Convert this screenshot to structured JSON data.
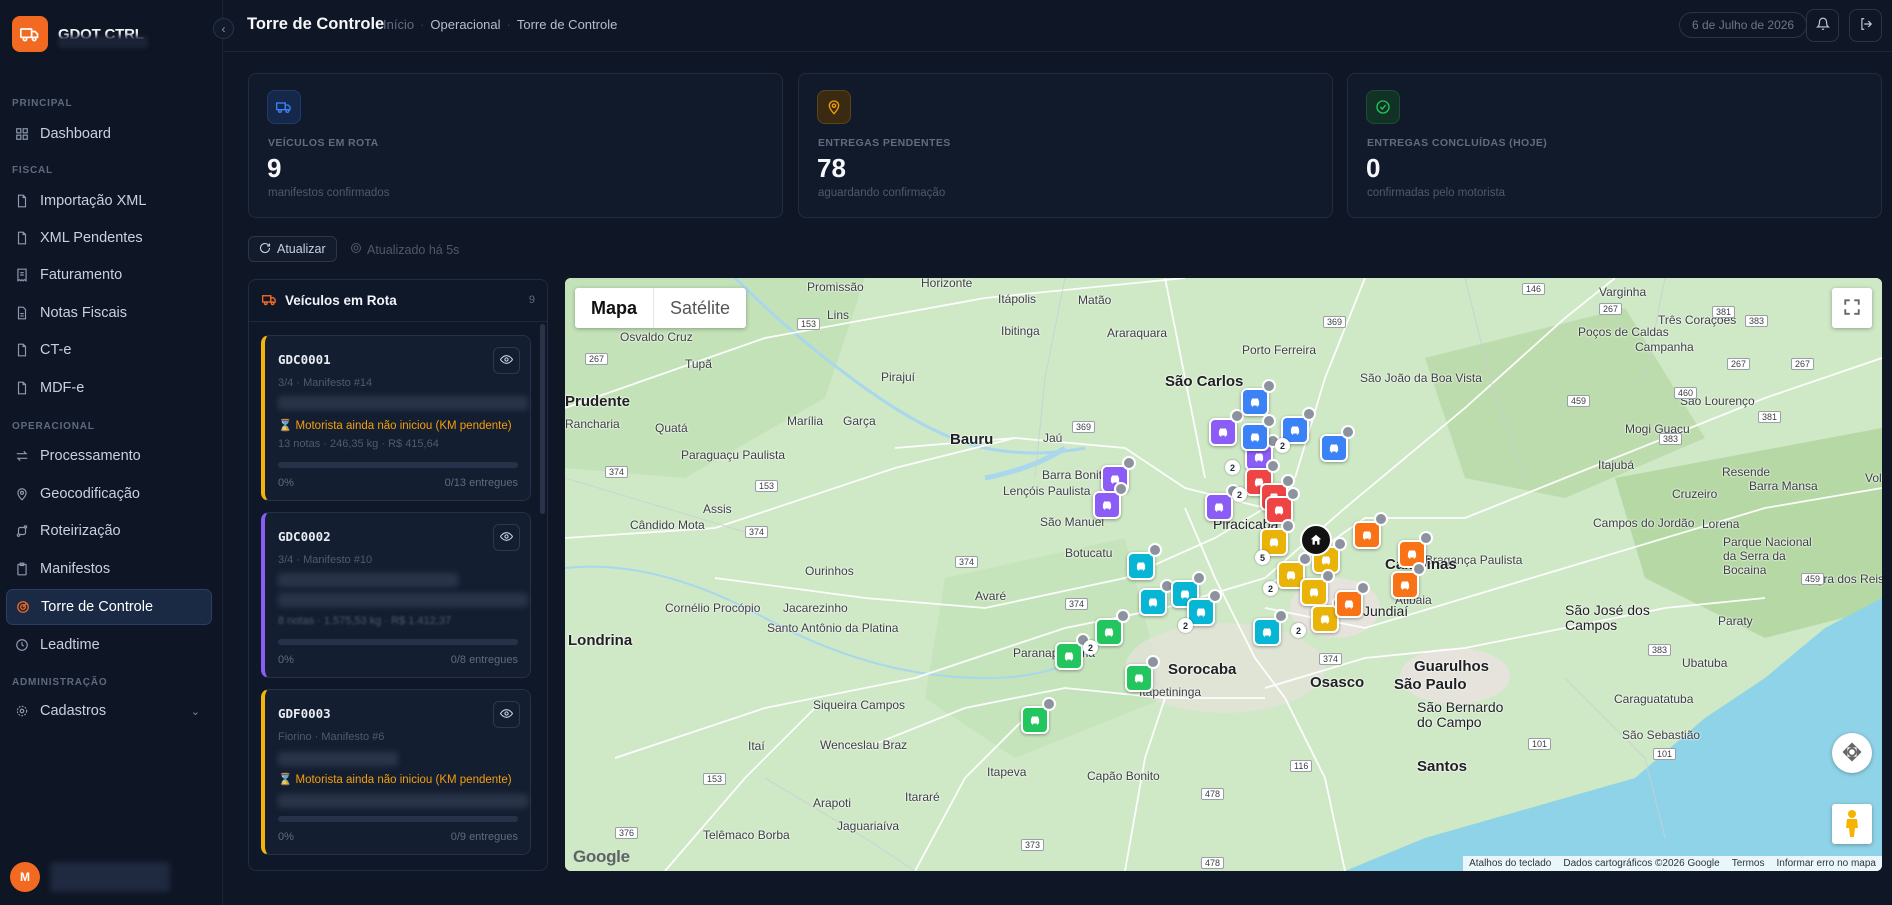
{
  "brand": {
    "name": "GDOT CTRL"
  },
  "sidebar": {
    "sections": {
      "principal": "PRINCIPAL",
      "fiscal": "FISCAL",
      "operacional": "OPERACIONAL",
      "administracao": "ADMINISTRAÇÃO"
    },
    "items": [
      {
        "label": "Dashboard",
        "icon": "grid-icon"
      },
      {
        "label": "Importação XML",
        "icon": "file-icon"
      },
      {
        "label": "XML Pendentes",
        "icon": "file-icon"
      },
      {
        "label": "Faturamento",
        "icon": "receipt-icon"
      },
      {
        "label": "Notas Fiscais",
        "icon": "file-icon"
      },
      {
        "label": "CT-e",
        "icon": "file-icon"
      },
      {
        "label": "MDF-e",
        "icon": "file-icon"
      },
      {
        "label": "Processamento",
        "icon": "arrows-icon"
      },
      {
        "label": "Geocodificação",
        "icon": "map-pin-icon"
      },
      {
        "label": "Roteirização",
        "icon": "route-icon"
      },
      {
        "label": "Manifestos",
        "icon": "clipboard-icon"
      },
      {
        "label": "Torre de Controle",
        "icon": "radar-icon",
        "active": true
      },
      {
        "label": "Leadtime",
        "icon": "clock-icon"
      },
      {
        "label": "Cadastros",
        "icon": "gear-icon"
      }
    ],
    "user_initial": "M"
  },
  "header": {
    "title": "Torre de Controle",
    "breadcrumb": [
      "Início",
      "Operacional",
      "Torre de Controle"
    ],
    "date": "6 de Julho de 2026"
  },
  "stats": [
    {
      "label": "VEÍCULOS EM ROTA",
      "value": "9",
      "sub": "manifestos confirmados",
      "color": "#3b82f6"
    },
    {
      "label": "ENTREGAS PENDENTES",
      "value": "78",
      "sub": "aguardando confirmação",
      "color": "#f59e0b"
    },
    {
      "label": "ENTREGAS CONCLUÍDAS (HOJE)",
      "value": "0",
      "sub": "confirmadas pelo motorista",
      "color": "#22c55e"
    }
  ],
  "toolbar": {
    "refresh_label": "Atualizar",
    "updated": "Atualizado há 5s"
  },
  "vehicles": {
    "title": "Veículos em Rota",
    "count": "9",
    "items": [
      {
        "plate": "GDC0001",
        "meta": "3/4 · Manifesto #14",
        "warning": "⌛ Motorista ainda não iniciou (KM pendente)",
        "info": "13 notas · 246,35 kg · R$ 415,64",
        "progress": 0,
        "pct": "0%",
        "deliveries": "0/13 entregues",
        "color": "#f5b40b"
      },
      {
        "plate": "GDC0002",
        "meta": "3/4 · Manifesto #10",
        "warning": "",
        "info": "8 notas · 1.575,53 kg · R$ 1.412,37",
        "progress": 0,
        "pct": "0%",
        "deliveries": "0/8 entregues",
        "color": "#8b5cf6"
      },
      {
        "plate": "GDF0003",
        "meta": "Fiorino · Manifesto #6",
        "warning": "⌛ Motorista ainda não iniciou (KM pendente)",
        "info": "",
        "progress": 0,
        "pct": "0%",
        "deliveries": "0/9 entregues",
        "color": "#f5b40b"
      }
    ]
  },
  "map": {
    "tabs": [
      "Mapa",
      "Satélite"
    ],
    "footer": [
      "Atalhos do teclado",
      "Dados cartográficos ©2026 Google",
      "Termos",
      "Informar erro no mapa"
    ],
    "logo": "Google",
    "places": {
      "big": [
        "Campinas",
        "Guarulhos",
        "São Paulo",
        "Sorocaba",
        "Bauru",
        "Londrina",
        "Osasco",
        "São Carlos",
        "Prudente",
        "Santos"
      ],
      "mid": [
        "São Bernardo do Campo",
        "São José dos Campos",
        "Piracicaba",
        "Jundiaí",
        "Atibaia",
        "Itapetininga"
      ],
      "small": [
        "Promissão",
        "Lins",
        "Horizonte",
        "Itápolis",
        "Matão",
        "Ibitinga",
        "Araraquara",
        "Porto Ferreira",
        "Varginha",
        "Três Corações",
        "Poços de Caldas",
        "Campanha",
        "São João da Boa Vista",
        "São Lourenço",
        "Osvaldo Cruz",
        "Tupã",
        "Pirajuí",
        "Marília",
        "Garça",
        "Jaú",
        "Quatá",
        "Rancharia",
        "Paraguaçu Paulista",
        "Barra Bonita",
        "Lençóis Paulista",
        "São Manuel",
        "Botucatu",
        "Assis",
        "Cândido Mota",
        "Ourinhos",
        "Avaré",
        "Cornélio Procópio",
        "Jacarezinho",
        "Santo Antônio da Platina",
        "Itaí",
        "Paranapanema",
        "Siqueira Campos",
        "Wenceslau Braz",
        "Itapeva",
        "Capão Bonito",
        "Arapoti",
        "Itararé",
        "Jaguariaíva",
        "Telêmaco Borba",
        "Mogi Guaçu",
        "Itajubá",
        "Resende",
        "Barra Mansa",
        "Cruzeiro",
        "Campos do Jordão",
        "Lorena",
        "Parque Nacional da Serra da Bocaina",
        "Paraty",
        "Ubatuba",
        "Caraguatatuba",
        "São Sebastião",
        "Bragança Paulista",
        "Angra dos Reis",
        "Volta Redonda",
        "Mogi das Cruzes"
      ]
    }
  }
}
